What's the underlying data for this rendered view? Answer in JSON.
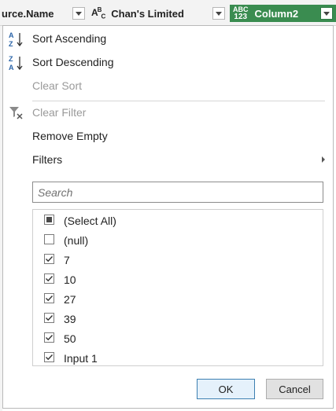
{
  "columns": [
    {
      "name": "urce.Name",
      "type": ""
    },
    {
      "name": "Chan's Limited",
      "type": "ABC"
    },
    {
      "name": "Column2",
      "type": "ABC 123",
      "type_top": "ABC",
      "type_bottom": "123"
    }
  ],
  "accent_color": "#3a8c50",
  "menu": {
    "sort_ascending": "Sort Ascending",
    "sort_descending": "Sort Descending",
    "clear_sort": "Clear Sort",
    "clear_filter": "Clear Filter",
    "remove_empty": "Remove Empty",
    "filters": "Filters"
  },
  "search": {
    "placeholder": "Search"
  },
  "values": [
    {
      "label": "(Select All)",
      "state": "partial"
    },
    {
      "label": "(null)",
      "state": "unchecked"
    },
    {
      "label": "7",
      "state": "checked"
    },
    {
      "label": "10",
      "state": "checked"
    },
    {
      "label": "27",
      "state": "checked"
    },
    {
      "label": "39",
      "state": "checked"
    },
    {
      "label": "50",
      "state": "checked"
    },
    {
      "label": "Input 1",
      "state": "checked"
    }
  ],
  "buttons": {
    "ok": "OK",
    "cancel": "Cancel"
  }
}
